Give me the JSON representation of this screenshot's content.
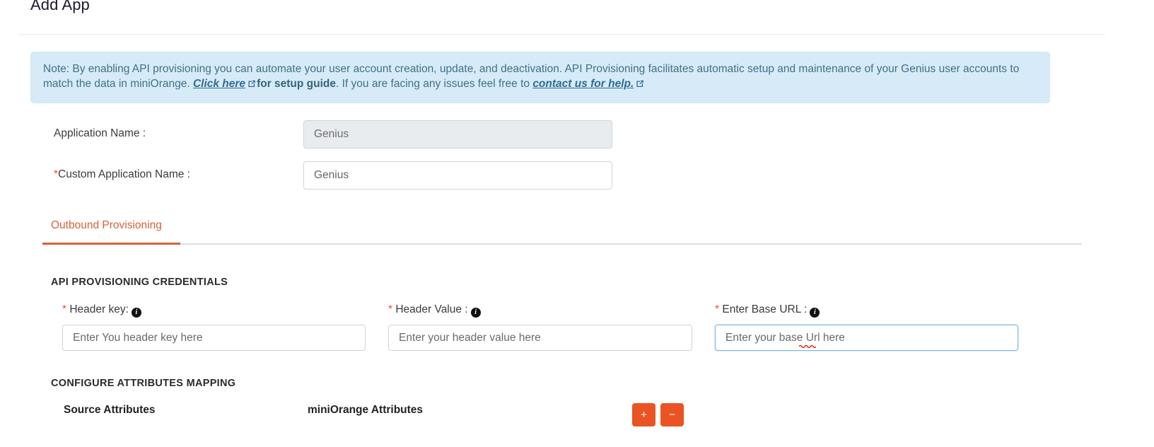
{
  "header": {
    "title": "Add App"
  },
  "note": {
    "part1": "Note: By enabling API provisioning you can automate your user account creation, update, and deactivation. API Provisioning facilitates automatic setup and maintenance of your Genius user accounts to match the data in miniOrange. ",
    "link1": "Click here",
    "part2": "for setup guide",
    "part3": ". If you are facing any issues feel free to ",
    "link2": "contact us for help.",
    "external_icon": "external-link-icon",
    "background_color": "#d6ebf7",
    "text_color": "#41708c"
  },
  "form": {
    "application_name": {
      "label": "Application Name :",
      "value": "Genius",
      "disabled": true
    },
    "custom_application_name": {
      "required_marker": "*",
      "label": "Custom Application Name :",
      "value": "Genius",
      "disabled": false
    }
  },
  "tabs": {
    "active_color": "#d9603a",
    "items": [
      {
        "label": "Outbound Provisioning",
        "active": true
      }
    ]
  },
  "credentials": {
    "section_title": "API PROVISIONING CREDENTIALS",
    "fields": [
      {
        "required_marker": "*",
        "label": "Header key:",
        "placeholder": "Enter You header key here",
        "value": "",
        "info_icon": "info-circle-icon",
        "focused": false
      },
      {
        "required_marker": "*",
        "label": "Header Value :",
        "placeholder": "Enter your header value here",
        "value": "",
        "info_icon": "info-circle-icon",
        "focused": false
      },
      {
        "required_marker": "*",
        "label": "Enter Base URL :",
        "placeholder": "Enter your base Url here",
        "value": "",
        "info_icon": "info-circle-icon",
        "focused": true
      }
    ]
  },
  "mapping": {
    "section_title": "CONFIGURE ATTRIBUTES MAPPING",
    "columns": [
      {
        "label": "Source Attributes"
      },
      {
        "label": "miniOrange Attributes"
      }
    ],
    "add_button_label": "+",
    "remove_button_label": "−",
    "button_color": "#ea5424"
  }
}
